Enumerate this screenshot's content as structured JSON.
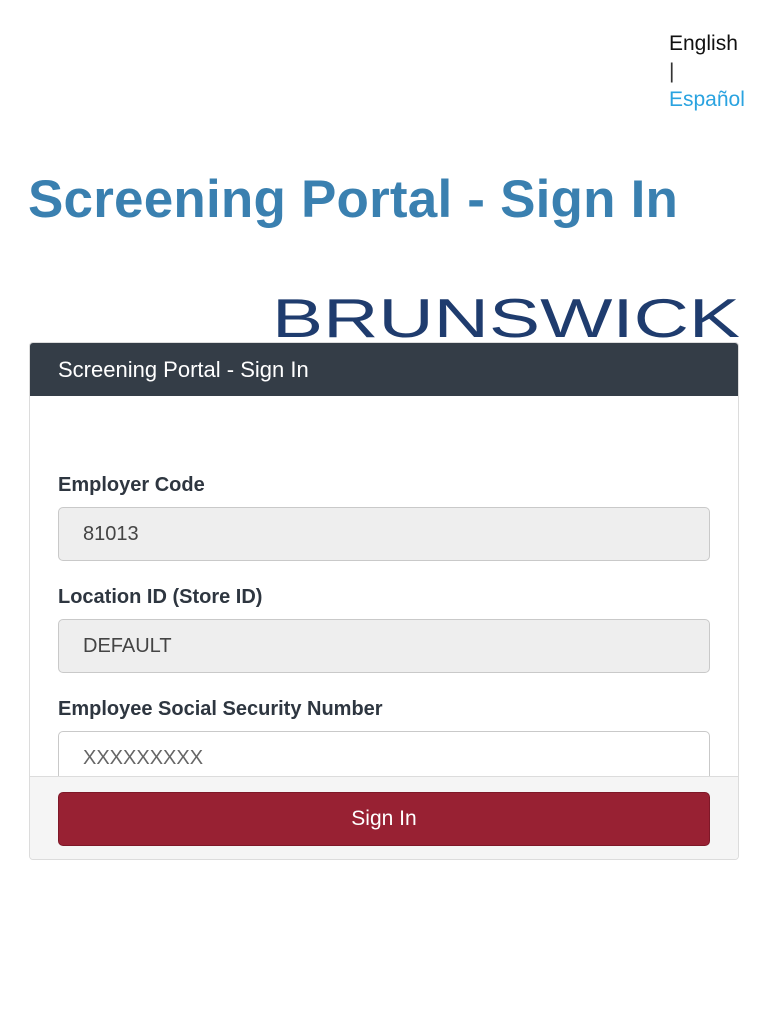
{
  "language": {
    "current": "English",
    "separator": "|",
    "other": "Español"
  },
  "page_title": "Screening Portal - Sign In",
  "logo": {
    "text": "BRUNSWICK",
    "color": "#1f3c6e"
  },
  "card": {
    "header": "Screening Portal - Sign In",
    "employer_code": {
      "label": "Employer Code",
      "value": "81013"
    },
    "location_id": {
      "label": "Location ID (Store ID)",
      "value": "DEFAULT"
    },
    "ssn": {
      "label": "Employee Social Security Number",
      "placeholder": "XXXXXXXXX"
    },
    "signin_label": "Sign In"
  },
  "colors": {
    "title": "#3a80b0",
    "header_bg": "#343d47",
    "button_bg": "#982133",
    "link": "#2aa3e0"
  }
}
